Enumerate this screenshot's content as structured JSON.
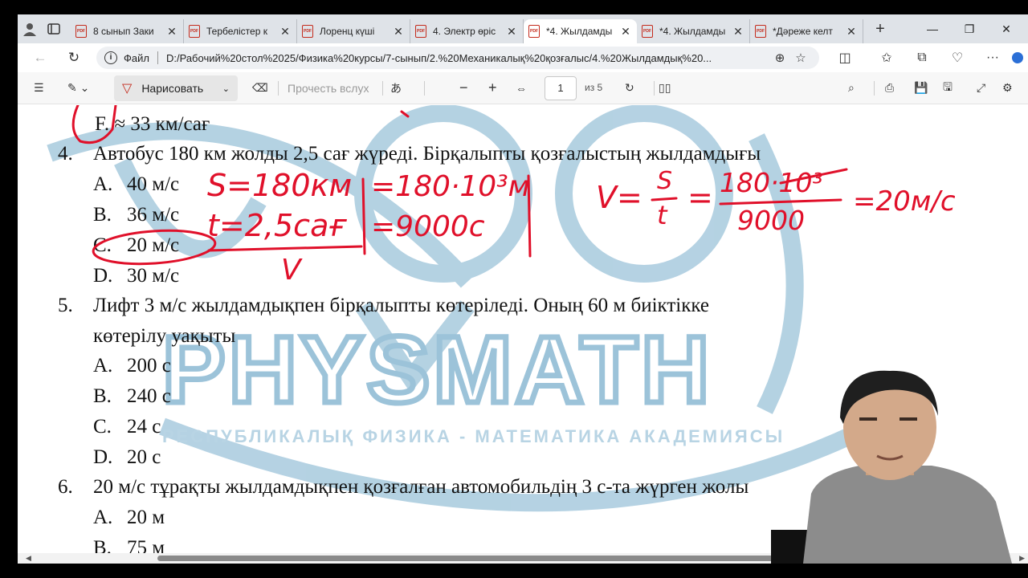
{
  "browser": {
    "tabs": [
      {
        "title": "8 сынып Заки",
        "active": false
      },
      {
        "title": "Тербелістер к",
        "active": false
      },
      {
        "title": "Лоренц күші",
        "active": false
      },
      {
        "title": "4. Электр өріс",
        "active": false
      },
      {
        "title": "*4. Жылдамды",
        "active": true
      },
      {
        "title": "*4. Жылдамды",
        "active": false
      },
      {
        "title": "*Дәреже келт",
        "active": false
      }
    ],
    "pdf_badge": "PDF",
    "address": {
      "file_label": "Файл",
      "url": "D:/Рабочий%20стол%2025/Физика%20курсы/7-сынып/2.%20Механикалық%20қозғалыс/4.%20Жылдамдық%20..."
    }
  },
  "pdf_toolbar": {
    "draw_label": "Нарисовать",
    "read_aloud_label": "Прочесть вслух",
    "page_current": "1",
    "page_total": "из 5"
  },
  "document": {
    "prev_answer": "F.  ≈ 33 км/сағ",
    "questions": [
      {
        "number": "4.",
        "text": "Автобус 180 км жолды 2,5 сағ жүреді. Бірқалыпты қозғалыстың жылдамдығы",
        "text2": "",
        "options": [
          {
            "letter": "A.",
            "value": "40 м/с"
          },
          {
            "letter": "B.",
            "value": "36 м/с"
          },
          {
            "letter": "C.",
            "value": "20 м/с"
          },
          {
            "letter": "D.",
            "value": "30 м/с"
          }
        ]
      },
      {
        "number": "5.",
        "text": "Лифт 3 м/с жылдамдықпен бірқалыпты көтеріледі. Оның 60 м биіктікке",
        "text2": "көтерілу уақыты",
        "options": [
          {
            "letter": "A.",
            "value": "200 с"
          },
          {
            "letter": "B.",
            "value": "240 с"
          },
          {
            "letter": "C.",
            "value": "24 с"
          },
          {
            "letter": "D.",
            "value": "20 с"
          }
        ]
      },
      {
        "number": "6.",
        "text": "20 м/с тұрақты жылдамдықпен қозғалған автомобильдің 3 с-та жүрген жолы",
        "text2": "",
        "options": [
          {
            "letter": "A.",
            "value": "20 м"
          },
          {
            "letter": "B.",
            "value": "75 м"
          }
        ]
      }
    ],
    "watermark": {
      "main": "PHYSMATH",
      "sub": "РЕСПУБЛИКАЛЫҚ ФИЗИКА - МАТЕМАТИКА АКАДЕМИЯСЫ"
    },
    "handwriting": {
      "s_given": "S=180км",
      "t_given": "t=2,5сағ",
      "v_find": "V",
      "s_si": "=180·10³м",
      "t_si": "=9000с",
      "formula_lhs": "V=",
      "formula_num": "S",
      "formula_den": "t",
      "calc_num": "180·10³",
      "calc_den": "9000",
      "result": "=20м/с"
    }
  },
  "colors": {
    "ink": "#e0102a",
    "watermark": "#9cc3d9",
    "tab_strip": "#dfe3e8"
  }
}
